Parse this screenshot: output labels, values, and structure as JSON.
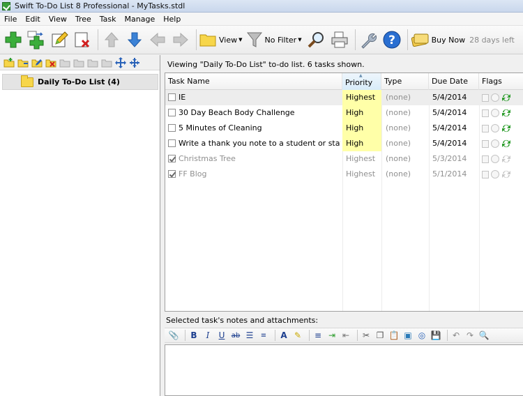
{
  "window": {
    "title": "Swift To-Do List 8 Professional - MyTasks.stdl"
  },
  "menu": [
    "File",
    "Edit",
    "View",
    "Tree",
    "Task",
    "Manage",
    "Help"
  ],
  "toolbar": {
    "view_label": "View",
    "filter_label": "No Filter",
    "buy_label": "Buy Now",
    "trial_label": "28 days left"
  },
  "tree": {
    "items": [
      {
        "label": "Daily To-Do List (4)"
      }
    ]
  },
  "viewing": {
    "text": "Viewing \"Daily To-Do List\" to-do list. 6 tasks shown."
  },
  "columns": {
    "name": "Task Name",
    "priority": "Priority",
    "type": "Type",
    "due": "Due Date",
    "flags": "Flags"
  },
  "tasks": [
    {
      "name": "IE",
      "priority": "Highest",
      "type": "(none)",
      "due": "5/4/2014",
      "done": false
    },
    {
      "name": "30 Day Beach Body Challenge",
      "priority": "High",
      "type": "(none)",
      "due": "5/4/2014",
      "done": false
    },
    {
      "name": "5 Minutes of Cleaning",
      "priority": "High",
      "type": "(none)",
      "due": "5/4/2014",
      "done": false
    },
    {
      "name": "Write a thank you note to a student or staff m...",
      "priority": "High",
      "type": "(none)",
      "due": "5/4/2014",
      "done": false
    },
    {
      "name": "Christmas Tree",
      "priority": "Highest",
      "type": "(none)",
      "due": "5/3/2014",
      "done": true
    },
    {
      "name": "FF Blog",
      "priority": "Highest",
      "type": "(none)",
      "due": "5/1/2014",
      "done": true
    }
  ],
  "notes": {
    "label": "Selected task's notes and attachments:"
  },
  "colors": {
    "priority_highlight": "#ffffa8",
    "selection": "#ededed",
    "repeat_green": "#2e9e2e"
  }
}
